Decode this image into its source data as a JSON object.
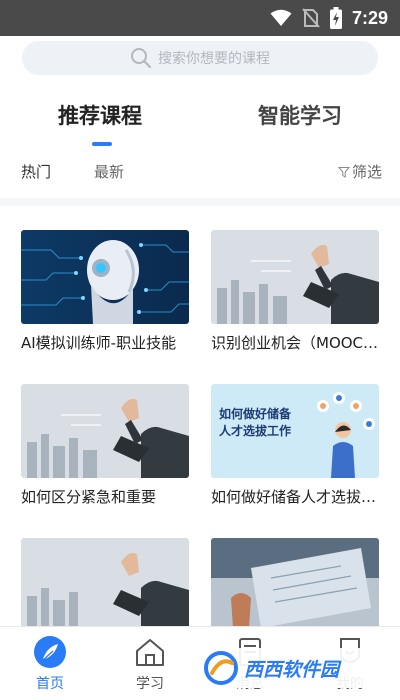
{
  "status": {
    "time": "7:29"
  },
  "search": {
    "placeholder": "搜索你想要的课程"
  },
  "main_tabs": [
    {
      "label": "推荐课程",
      "active": true
    },
    {
      "label": "智能学习",
      "active": false
    }
  ],
  "filters": {
    "hot": "热门",
    "latest": "最新",
    "screen": "筛选"
  },
  "courses": [
    {
      "title": "AI模拟训练师-职业技能"
    },
    {
      "title": "识别创业机会（MOOC版）"
    },
    {
      "title": "如何区分紧急和重要"
    },
    {
      "title": "如何做好储备人才选拔工作"
    },
    {
      "title": ""
    },
    {
      "title": ""
    }
  ],
  "course_banner": {
    "line1": "如何做好储备",
    "line2": "人才选拔工作"
  },
  "bottom_nav": [
    {
      "label": "首页",
      "icon": "feather-icon",
      "active": true
    },
    {
      "label": "学习",
      "icon": "house-icon",
      "active": false
    },
    {
      "label": "消息",
      "icon": "message-icon",
      "active": false
    },
    {
      "label": "我的",
      "icon": "profile-icon",
      "active": false
    }
  ],
  "watermark": {
    "text": "西西软件园"
  },
  "colors": {
    "accent": "#2a7bf6",
    "statusbar": "#4a4a4a"
  }
}
